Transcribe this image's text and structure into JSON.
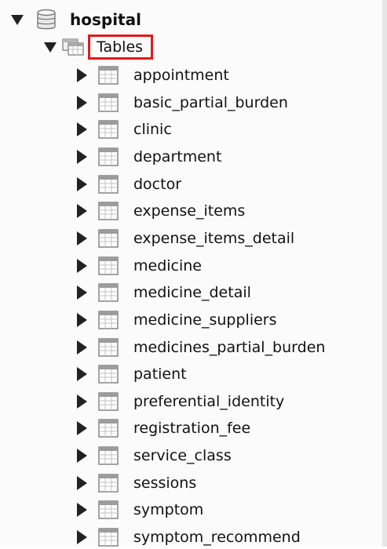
{
  "tree": {
    "database": {
      "name": "hospital",
      "icon": "database-icon",
      "expanded": true
    },
    "tables_folder": {
      "label": "Tables",
      "icon": "tables-folder-icon",
      "expanded": true,
      "highlight_color": "#e21a1a"
    },
    "tables": [
      {
        "name": "appointment",
        "icon": "table-icon"
      },
      {
        "name": "basic_partial_burden",
        "icon": "table-icon"
      },
      {
        "name": "clinic",
        "icon": "table-icon"
      },
      {
        "name": "department",
        "icon": "table-icon"
      },
      {
        "name": "doctor",
        "icon": "table-icon"
      },
      {
        "name": "expense_items",
        "icon": "table-icon"
      },
      {
        "name": "expense_items_detail",
        "icon": "table-icon"
      },
      {
        "name": "medicine",
        "icon": "table-icon"
      },
      {
        "name": "medicine_detail",
        "icon": "table-icon"
      },
      {
        "name": "medicine_suppliers",
        "icon": "table-icon"
      },
      {
        "name": "medicines_partial_burden",
        "icon": "table-icon"
      },
      {
        "name": "patient",
        "icon": "table-icon"
      },
      {
        "name": "preferential_identity",
        "icon": "table-icon"
      },
      {
        "name": "registration_fee",
        "icon": "table-icon"
      },
      {
        "name": "service_class",
        "icon": "table-icon"
      },
      {
        "name": "sessions",
        "icon": "table-icon"
      },
      {
        "name": "symptom",
        "icon": "table-icon"
      },
      {
        "name": "symptom_recommend",
        "icon": "table-icon"
      }
    ]
  }
}
